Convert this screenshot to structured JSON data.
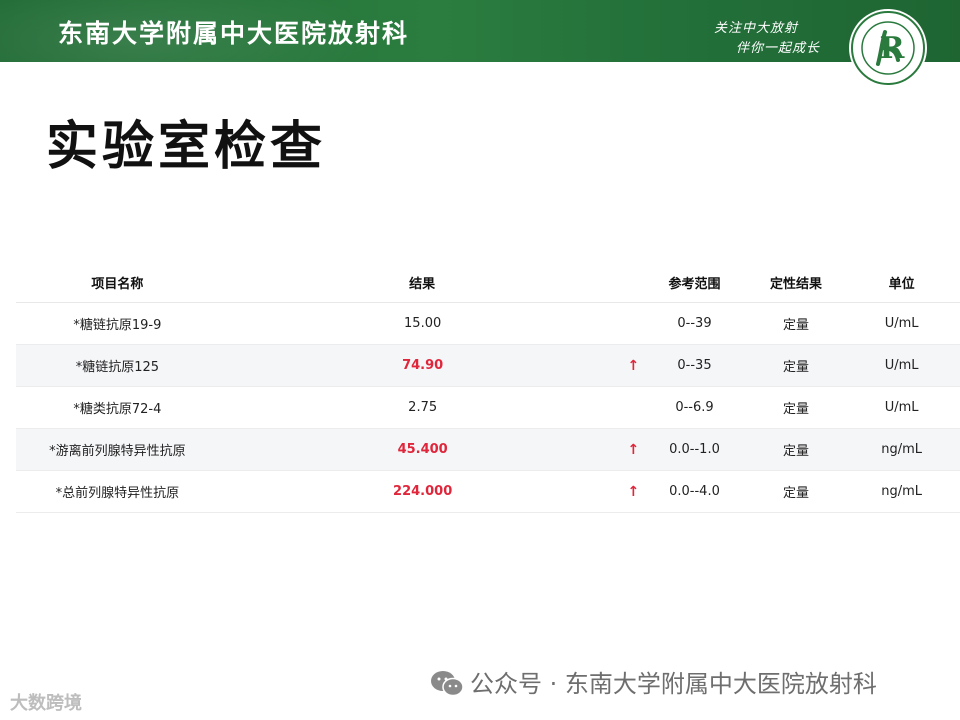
{
  "header": {
    "title": "东南大学附属中大医院放射科",
    "slogan_line1": "关注中大放射",
    "slogan_line2": "伴你一起成长",
    "logo_letter": "R",
    "brand_color": "#236f38"
  },
  "page_title": "实验室检查",
  "table": {
    "columns": [
      "项目名称",
      "结果",
      "",
      "参考范围",
      "定性结果",
      "单位"
    ],
    "rows": [
      {
        "name": "*糖链抗原19-9",
        "result": "15.00",
        "flag": "",
        "range": "0--39",
        "qualitative": "定量",
        "unit": "U/mL"
      },
      {
        "name": "*糖链抗原125",
        "result": "74.90",
        "flag": "↑",
        "range": "0--35",
        "qualitative": "定量",
        "unit": "U/mL"
      },
      {
        "name": "*糖类抗原72-4",
        "result": "2.75",
        "flag": "",
        "range": "0--6.9",
        "qualitative": "定量",
        "unit": "U/mL"
      },
      {
        "name": "*游离前列腺特异性抗原",
        "result": "45.400",
        "flag": "↑",
        "range": "0.0--1.0",
        "qualitative": "定量",
        "unit": "ng/mL"
      },
      {
        "name": "*总前列腺特异性抗原",
        "result": "224.000",
        "flag": "↑",
        "range": "0.0--4.0",
        "qualitative": "定量",
        "unit": "ng/mL"
      }
    ],
    "high_color": "#e0263b"
  },
  "watermark": {
    "icon": "wechat-icon",
    "text": "公众号 · 东南大学附属中大医院放射科"
  },
  "corner_mark": "大数跨境"
}
